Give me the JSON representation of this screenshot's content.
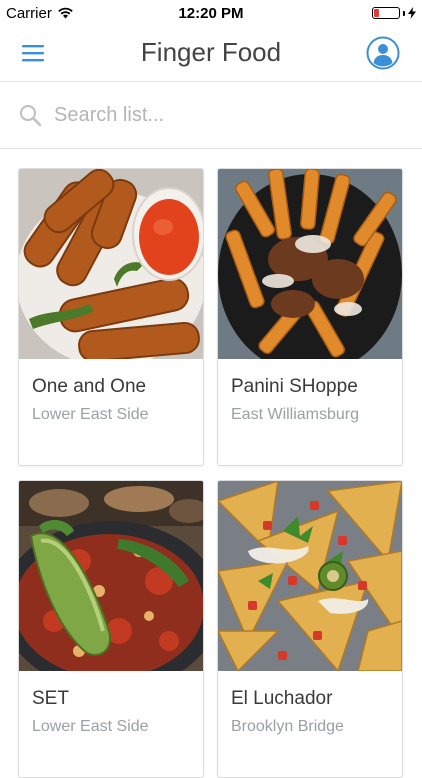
{
  "status_bar": {
    "carrier": "Carrier",
    "time": "12:20 PM",
    "battery_level": 0.2,
    "battery_color": "#e53935"
  },
  "nav": {
    "title": "Finger Food",
    "menu_icon": "hamburger-menu-icon",
    "profile_icon": "user-profile-icon",
    "accent_color": "#3b8fd6"
  },
  "search": {
    "placeholder": "Search list...",
    "value": ""
  },
  "restaurants": [
    {
      "name": "One and One",
      "neighborhood": "Lower East Side"
    },
    {
      "name": "Panini SHoppe",
      "neighborhood": "East Williamsburg"
    },
    {
      "name": "SET",
      "neighborhood": "Lower East Side"
    },
    {
      "name": "El Luchador",
      "neighborhood": "Brooklyn Bridge"
    }
  ]
}
